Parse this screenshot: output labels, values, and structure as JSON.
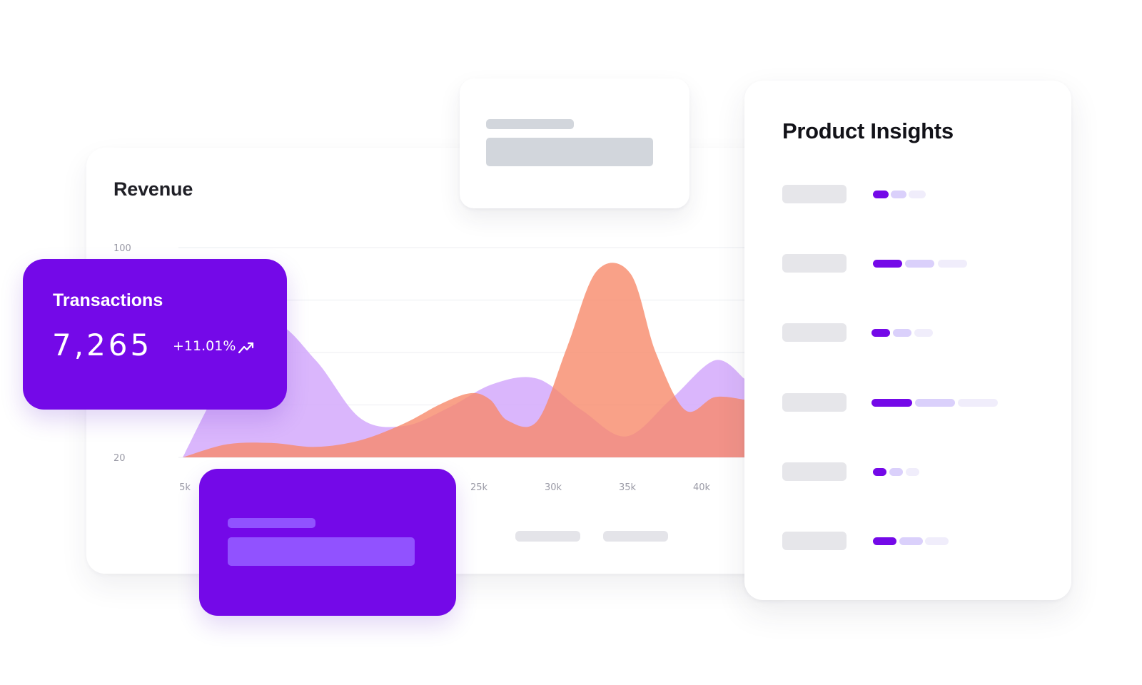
{
  "revenue": {
    "title": "Revenue",
    "y_ticks": [
      "100",
      "20"
    ],
    "x_ticks": [
      "5k",
      "25k",
      "30k",
      "35k",
      "40k"
    ]
  },
  "transactions": {
    "title": "Transactions",
    "value": "7,265",
    "change": "+11.01%",
    "icon": "trend-up-icon"
  },
  "insights": {
    "title": "Product Insights",
    "rows": [
      {
        "segments": 3
      },
      {
        "segments": 3
      },
      {
        "segments": 3
      },
      {
        "segments": 3
      },
      {
        "segments": 3
      },
      {
        "segments": 3
      }
    ]
  },
  "colors": {
    "accent_purple": "#7409e8",
    "series_orange": "#f7896a",
    "series_lavender": "#d3a9fb",
    "skeleton_gray": "#d2d6dc",
    "skeleton_purple": "#9152ff"
  },
  "chart_data": {
    "type": "area",
    "title": "Revenue",
    "xlabel": "",
    "ylabel": "",
    "x_tick_labels": [
      "5k",
      "25k",
      "30k",
      "35k",
      "40k"
    ],
    "y_tick_labels": [
      "100",
      "20"
    ],
    "ylim": [
      20,
      100
    ],
    "grid": true,
    "series": [
      {
        "color": "#d3a9fb",
        "x": [
          5,
          8,
          11,
          14,
          17,
          20,
          23,
          26,
          29,
          32,
          35,
          38,
          41,
          43
        ],
        "values": [
          20,
          52,
          71,
          57,
          35,
          32,
          39,
          48,
          50,
          38,
          28,
          42,
          57,
          50
        ]
      },
      {
        "color": "#f7896a",
        "x": [
          5,
          8,
          11,
          14,
          17,
          20,
          22.5,
          24.5,
          25.8,
          27,
          29,
          31,
          33,
          35.3,
          37,
          39,
          41,
          43
        ],
        "values": [
          20,
          25,
          25.5,
          24,
          26.5,
          33,
          40.5,
          44.5,
          42,
          34,
          34,
          62,
          91,
          90,
          60,
          38,
          43,
          42
        ]
      }
    ]
  }
}
